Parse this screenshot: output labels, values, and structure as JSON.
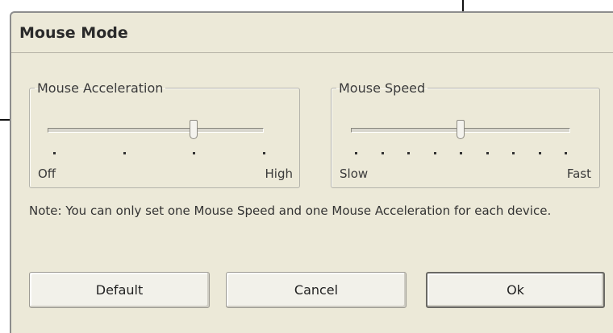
{
  "dialog": {
    "title": "Mouse Mode"
  },
  "acceleration": {
    "legend": "Mouse Acceleration",
    "min_label": "Off",
    "max_label": "High",
    "steps": 4,
    "value": 3
  },
  "speed": {
    "legend": "Mouse Speed",
    "min_label": "Slow",
    "max_label": "Fast",
    "steps": 9,
    "value": 5
  },
  "note": "Note: You can only set one Mouse Speed and one Mouse Acceleration for each device.",
  "buttons": {
    "default": "Default",
    "cancel": "Cancel",
    "ok": "Ok"
  }
}
